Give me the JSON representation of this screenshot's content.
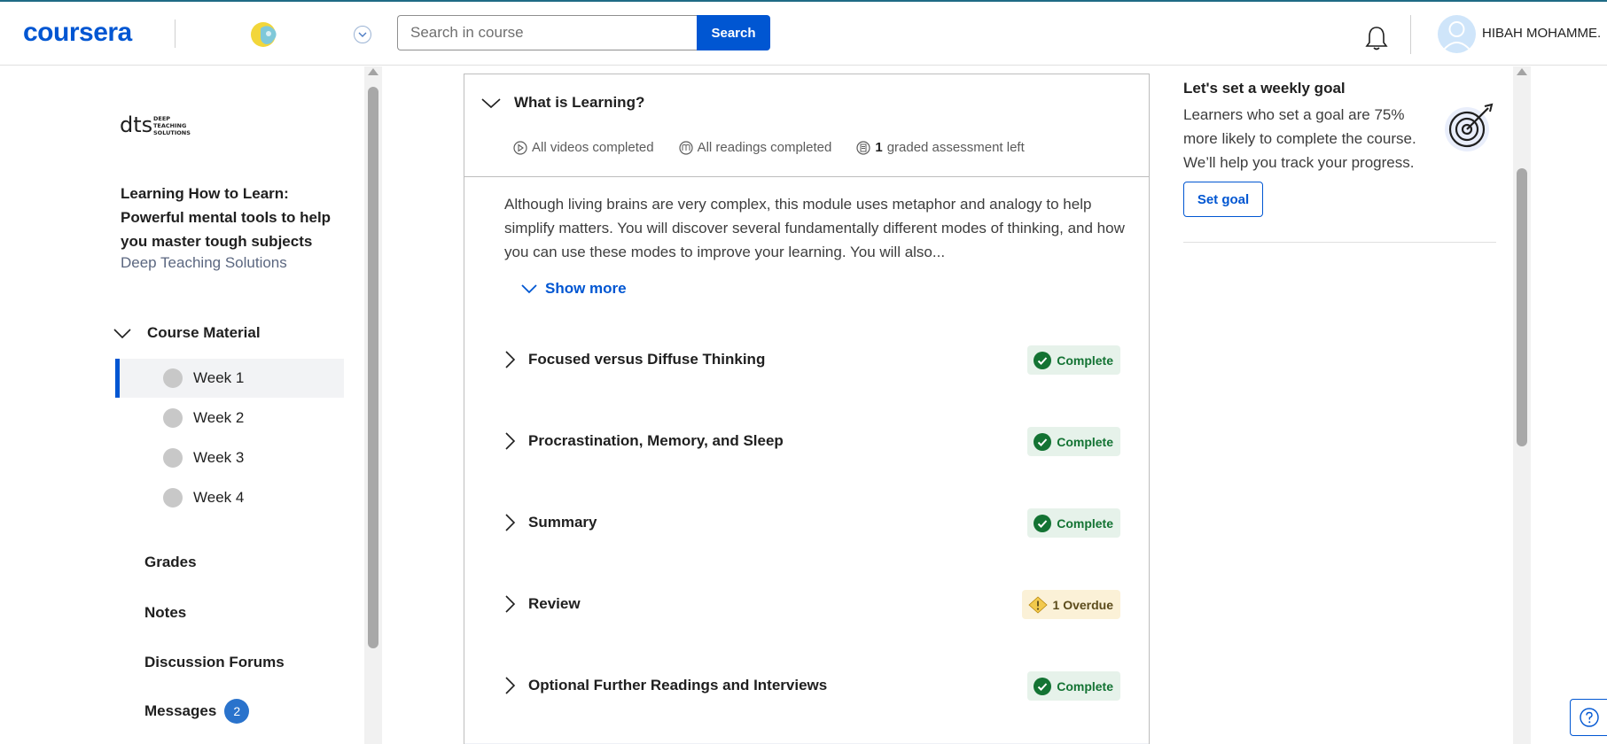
{
  "header": {
    "brand": "coursera",
    "search_placeholder": "Search in course",
    "search_button": "Search",
    "username": "HIBAH MOHAMME..."
  },
  "sidebar": {
    "partner_logo_text": [
      "DEEP",
      "TEACHING",
      "SOLUTIONS"
    ],
    "course_title": "Learning How to Learn: Powerful mental tools to help you master tough subjects",
    "course_partner": "Deep Teaching Solutions",
    "course_material_label": "Course Material",
    "weeks": [
      {
        "label": "Week 1",
        "active": true
      },
      {
        "label": "Week 2",
        "active": false
      },
      {
        "label": "Week 3",
        "active": false
      },
      {
        "label": "Week 4",
        "active": false
      }
    ],
    "links": [
      {
        "label": "Grades"
      },
      {
        "label": "Notes"
      },
      {
        "label": "Discussion Forums"
      },
      {
        "label": "Messages",
        "badge": "2"
      }
    ]
  },
  "module": {
    "title": "What is Learning?",
    "stats": {
      "videos": "All videos completed",
      "readings": "All readings completed",
      "graded_count": "1",
      "graded_text": "graded assessment left"
    },
    "description": "Although living brains are very complex, this module uses metaphor and analogy to help simplify matters. You will discover several fundamentally different modes of thinking, and how you can use these modes to improve your learning. You will also...",
    "show_more": "Show more",
    "lessons": [
      {
        "title": "Focused versus Diffuse Thinking",
        "status": "Complete",
        "status_type": "complete"
      },
      {
        "title": "Procrastination, Memory, and Sleep",
        "status": "Complete",
        "status_type": "complete"
      },
      {
        "title": "Summary",
        "status": "Complete",
        "status_type": "complete"
      },
      {
        "title": "Review",
        "status": "1 Overdue",
        "status_type": "overdue"
      },
      {
        "title": "Optional Further Readings and Interviews",
        "status": "Complete",
        "status_type": "complete"
      }
    ]
  },
  "goal": {
    "title": "Let's set a weekly goal",
    "text": "Learners who set a goal are 75% more likely to complete the course. We’ll help you track your progress.",
    "button": "Set goal"
  },
  "colors": {
    "brand_blue": "#0056d2",
    "complete_green": "#137333",
    "overdue_amber": "#f2c94c"
  }
}
